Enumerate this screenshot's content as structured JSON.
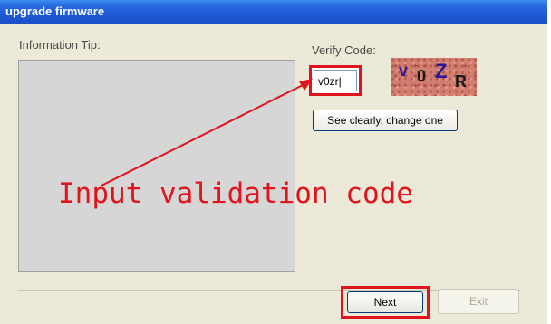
{
  "window": {
    "title": "upgrade firmware"
  },
  "info": {
    "label": "Information Tip:"
  },
  "verify": {
    "label": "Verify Code:",
    "input_value": "v0zr",
    "captcha_chars": [
      "v",
      "0",
      "Z",
      "R"
    ],
    "change_label": "See clearly, change one"
  },
  "footer": {
    "next_label": "Next",
    "exit_label": "Exit"
  },
  "annotation": {
    "text": "Input validation code",
    "color": "#e0141c"
  },
  "colors": {
    "titlebar": "#1f5ad6",
    "window_bg": "#ece9d8",
    "highlight": "#e0141c",
    "captcha_bg": "#d27d6e"
  }
}
